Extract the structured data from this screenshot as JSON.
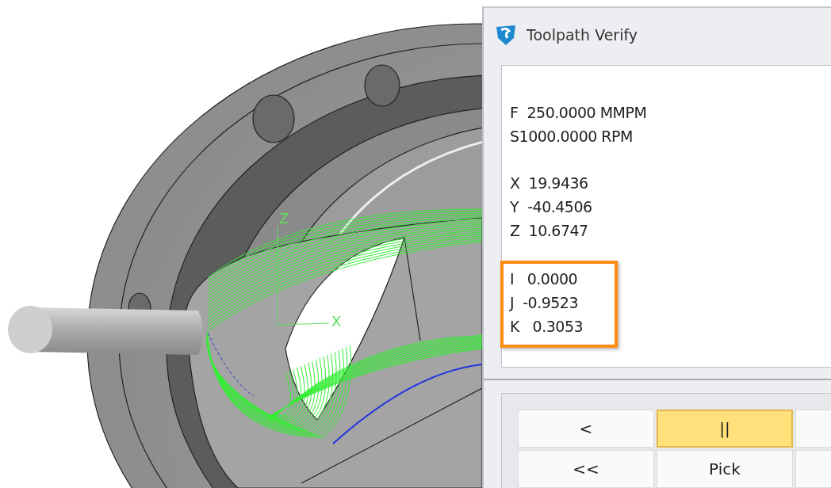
{
  "viewport": {
    "axis_labels": [
      {
        "text": "Z"
      },
      {
        "text": "X"
      }
    ]
  },
  "dialog": {
    "title": "Toolpath Verify",
    "readouts": [
      {
        "kind": "plain",
        "lines": [
          "F  250.0000 MMPM",
          "S1000.0000 RPM"
        ]
      },
      {
        "kind": "plain",
        "lines": [
          "X  19.9436",
          "Y  -40.4506",
          "Z  10.6747"
        ]
      },
      {
        "kind": "highlighted",
        "lines": [
          "I   0.0000",
          "J  -0.9523",
          "K   0.3053"
        ]
      }
    ],
    "controls": [
      [
        {
          "label": "<",
          "selected": false
        },
        {
          "label": "||",
          "selected": true
        },
        {
          "selected": false
        }
      ],
      [
        {
          "label": "<<",
          "selected": false
        },
        {
          "label": "Pick",
          "selected": false
        },
        {
          "selected": false
        }
      ]
    ]
  }
}
